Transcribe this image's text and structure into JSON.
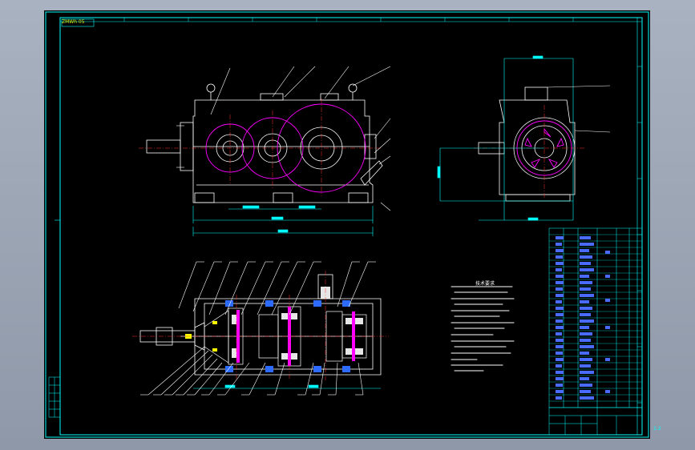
{
  "sheet": {
    "title_tag": "ZMWh 05",
    "notes_title": "技术要求",
    "scale_value": "1:2"
  },
  "colors": {
    "background": "#000000",
    "frame": "#00ffff",
    "outline": "#ffffff",
    "gear": "#ff00ff",
    "dimension": "#00ffff",
    "leader": "#ffffff",
    "table_text": "#4a6bff",
    "tag": "#e0e000"
  },
  "icons": [
    "gear-wheel-icon",
    "bearing-icon",
    "bolt-icon"
  ]
}
